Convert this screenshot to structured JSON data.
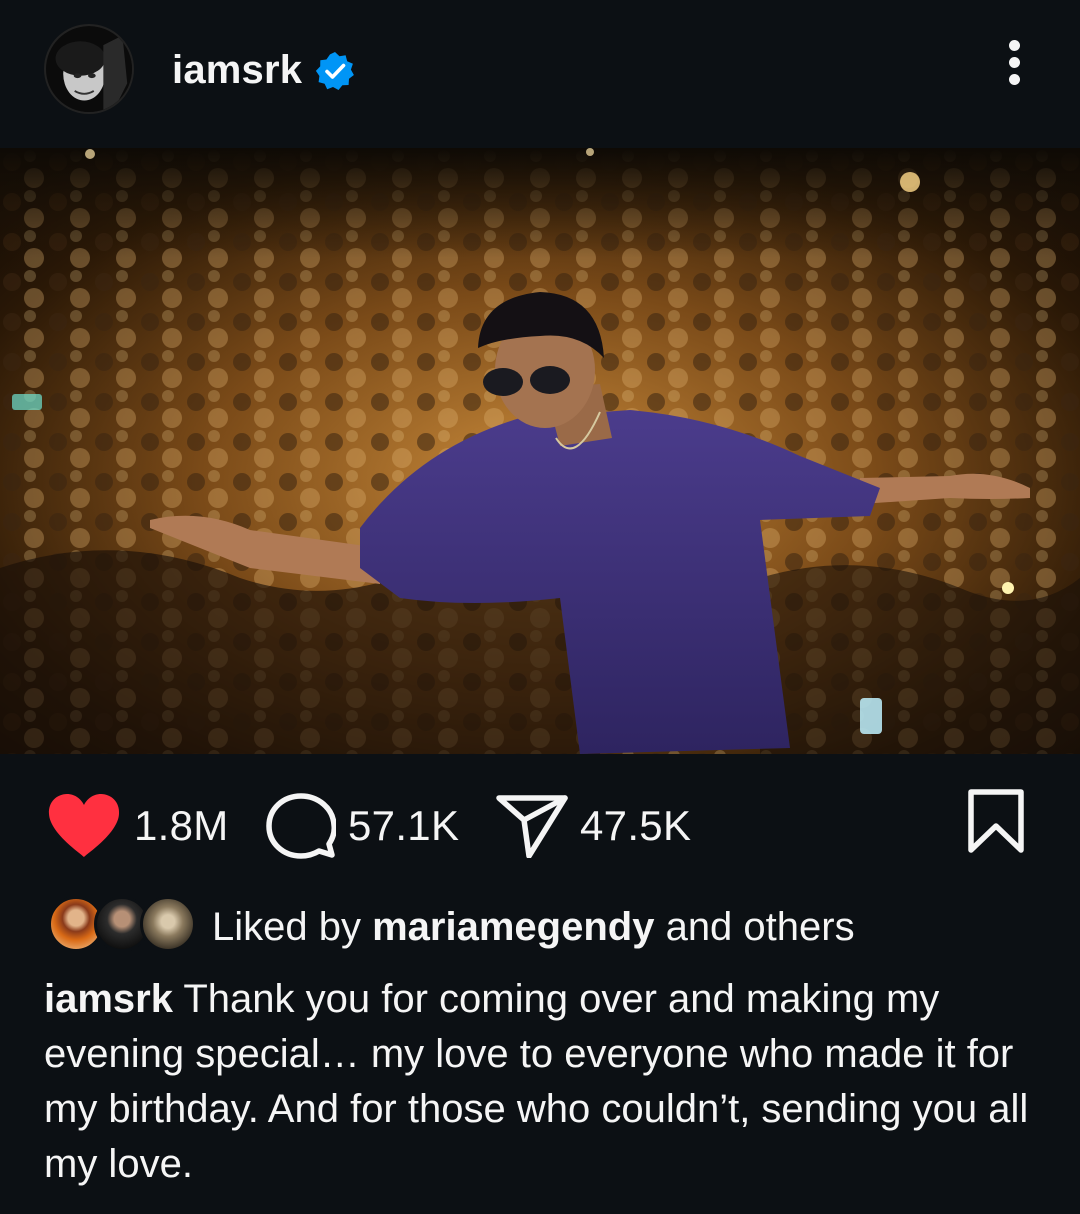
{
  "post": {
    "username": "iamsrk",
    "verified": true,
    "more_icon": "more-vertical-icon",
    "photo_alt": "iamsrk post photo",
    "stats": {
      "likes": "1.8M",
      "comments": "57.1K",
      "shares": "47.5K"
    },
    "liked_by": {
      "prefix": "Liked by ",
      "user": "mariamegendy",
      "suffix": " and others"
    },
    "caption": {
      "author": "iamsrk",
      "text": " Thank you for coming over and making my evening special… my love to everyone who made it for my birthday. And for those who couldn’t, sending you all my love."
    },
    "colors": {
      "background": "#0c1014",
      "like_red": "#ff3040",
      "verified_blue": "#0095f6",
      "text": "#f5f5f5"
    }
  }
}
